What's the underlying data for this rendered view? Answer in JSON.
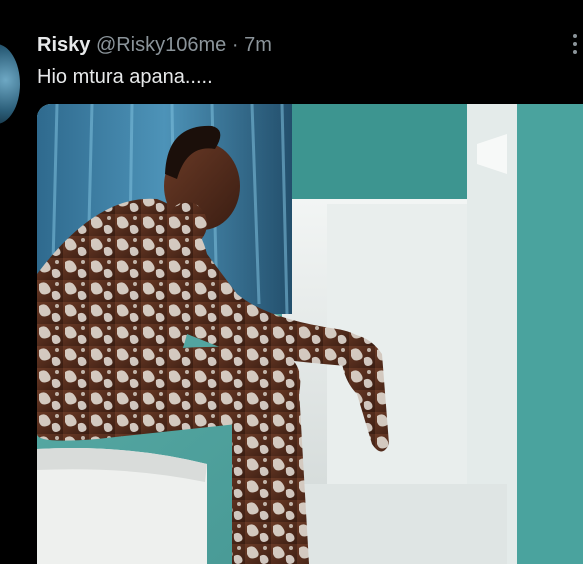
{
  "tweet": {
    "author_name": "Risky",
    "author_handle": "@Risky106me",
    "separator": "·",
    "time": "7m",
    "text": "Hio mtura apana....."
  },
  "icons": {
    "avatar": "user-avatar",
    "more": "more-options-icon"
  },
  "colors": {
    "background": "#000000",
    "primary_text": "#e7e9ea",
    "secondary_text": "#8b949a"
  }
}
